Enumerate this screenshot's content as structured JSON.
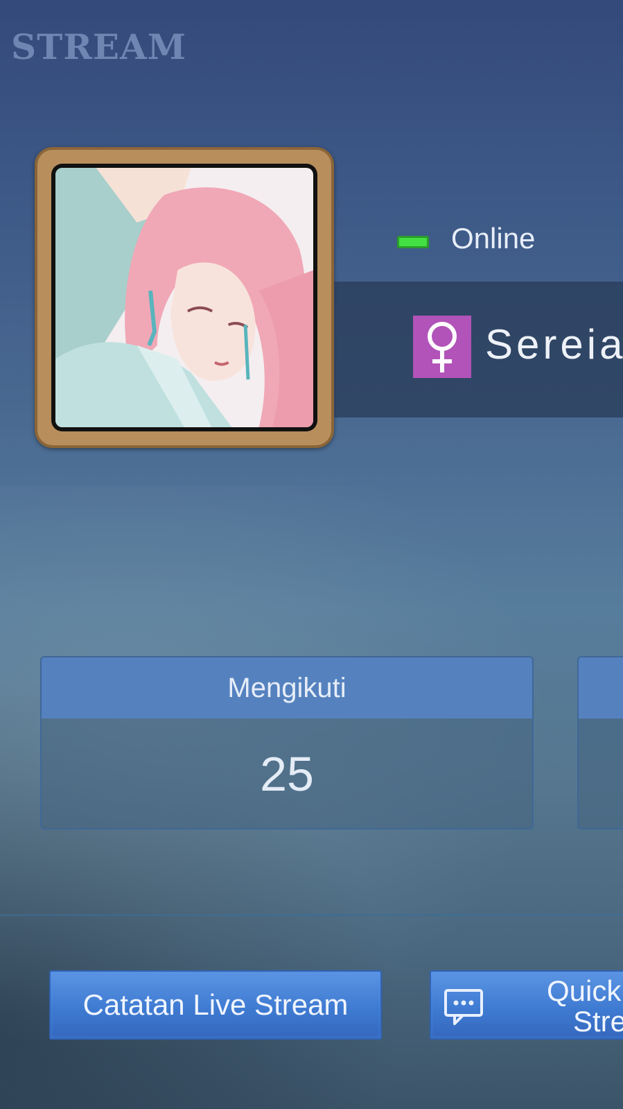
{
  "header": {
    "title": "STREAM"
  },
  "profile": {
    "status": "Online",
    "name": "Sereia",
    "gender_icon": "female-icon",
    "colors": {
      "status": "#43e043",
      "gender_badge": "#b153b8",
      "frame": "#b88e5c"
    }
  },
  "stats": [
    {
      "label": "Mengikuti",
      "value": "25"
    }
  ],
  "actions": {
    "live_stream_log": "Catatan Live Stream",
    "quick_stream_line1": "Quick",
    "quick_stream_line2": "Stre"
  }
}
